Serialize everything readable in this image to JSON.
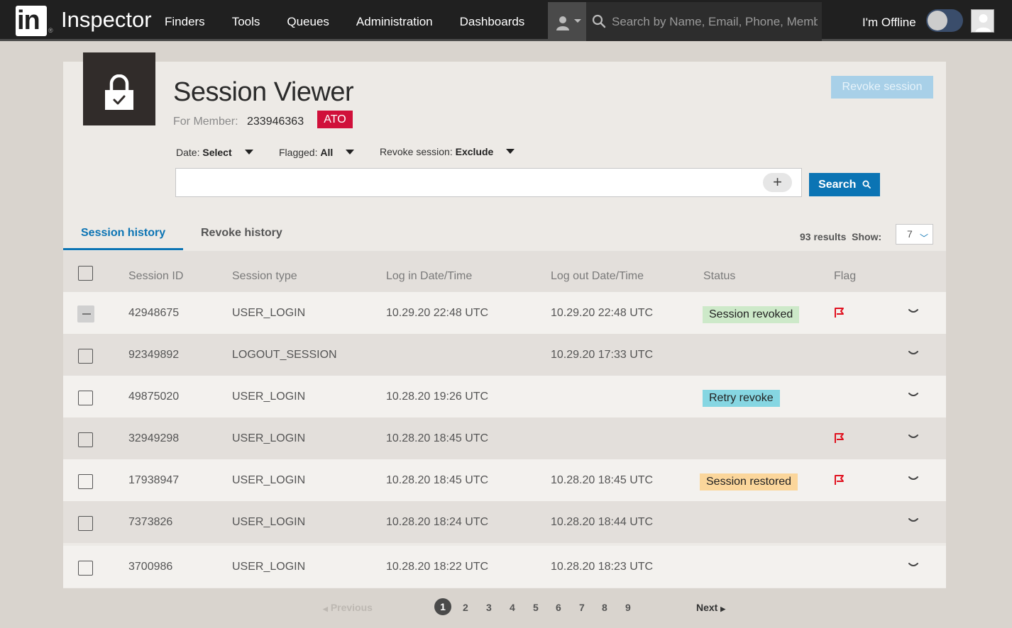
{
  "nav": {
    "logo_text": "in",
    "brand": "Inspector",
    "links": [
      "Finders",
      "Tools",
      "Queues",
      "Administration",
      "Dashboards"
    ],
    "search_placeholder": "Search by Name, Email, Phone, Member ID",
    "offline_label": "I'm Offline"
  },
  "header": {
    "title": "Session Viewer",
    "for_member_label": "For Member:",
    "member_id": "233946363",
    "ato_badge": "ATO",
    "revoke_button": "Revoke session"
  },
  "filters": {
    "date": {
      "label": "Date:",
      "value": "Select"
    },
    "flagged": {
      "label": "Flagged:",
      "value": "All"
    },
    "revoke": {
      "label": "Revoke session:",
      "value": "Exclude"
    }
  },
  "search": {
    "value": "",
    "plus": "+",
    "button": "Search"
  },
  "tabs": {
    "active": "Session history",
    "inactive": "Revoke history"
  },
  "results": {
    "text": "93 results",
    "show_label": "Show:",
    "show_value": "7"
  },
  "table": {
    "columns": [
      "Session ID",
      "Session type",
      "Log in Date/Time",
      "Log out Date/Time",
      "Status",
      "Flag"
    ],
    "rows": [
      {
        "id": "42948675",
        "type": "USER_LOGIN",
        "login": "10.29.20 22:48 UTC",
        "logout": "10.29.20 22:48 UTC",
        "status": "Session revoked",
        "status_kind": "revoked",
        "flag": true,
        "check": "indeterminate"
      },
      {
        "id": "92349892",
        "type": "LOGOUT_SESSION",
        "login": "",
        "logout": "10.29.20 17:33 UTC",
        "status": "",
        "status_kind": "",
        "flag": false,
        "check": "unchecked"
      },
      {
        "id": "49875020",
        "type": "USER_LOGIN",
        "login": "10.28.20 19:26 UTC",
        "logout": "",
        "status": "Retry revoke",
        "status_kind": "retry",
        "flag": false,
        "check": "unchecked"
      },
      {
        "id": "32949298",
        "type": "USER_LOGIN",
        "login": "10.28.20 18:45 UTC",
        "logout": "",
        "status": "",
        "status_kind": "",
        "flag": true,
        "check": "unchecked"
      },
      {
        "id": "17938947",
        "type": "USER_LOGIN",
        "login": "10.28.20 18:45 UTC",
        "logout": "10.28.20 18:45 UTC",
        "status": "Session restored",
        "status_kind": "restored",
        "flag": true,
        "check": "unchecked"
      },
      {
        "id": "7373826",
        "type": "USER_LOGIN",
        "login": "10.28.20 18:24 UTC",
        "logout": "10.28.20 18:44 UTC",
        "status": "",
        "status_kind": "",
        "flag": false,
        "check": "unchecked"
      },
      {
        "id": "3700986",
        "type": "USER_LOGIN",
        "login": "10.28.20 18:22 UTC",
        "logout": "10.28.20 18:23 UTC",
        "status": "",
        "status_kind": "",
        "flag": false,
        "check": "unchecked"
      }
    ]
  },
  "pagination": {
    "previous": "Previous",
    "pages": [
      "1",
      "2",
      "3",
      "4",
      "5",
      "6",
      "7",
      "8",
      "9"
    ],
    "current": "1",
    "next": "Next"
  },
  "colors": {
    "accent": "#0b74b4",
    "ato": "#d0103a",
    "flag": "#e0101e",
    "revoked": "#cde9c9",
    "retry": "#86d6e2",
    "restored": "#fbd69b"
  }
}
